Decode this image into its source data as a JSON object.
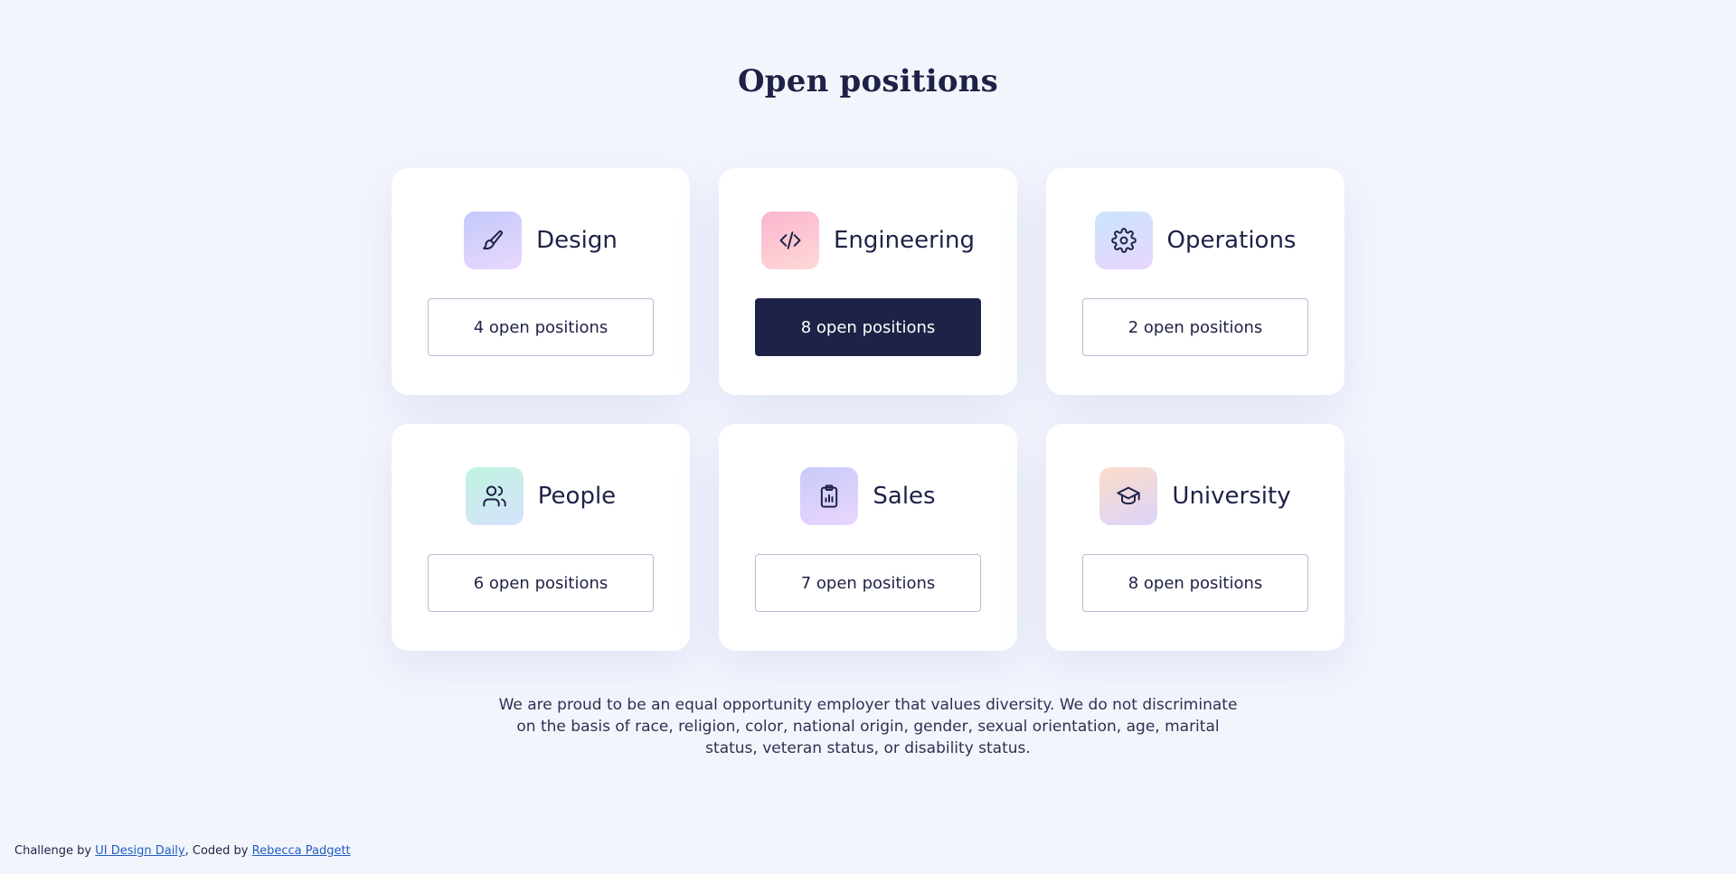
{
  "page": {
    "title": "Open positions",
    "statement": "We are proud to be an equal opportunity employer that values diversity. We do not discriminate on the basis of race, religion, color, national origin, gender, sexual orientation, age, marital status, veteran status, or disability status."
  },
  "departments": [
    {
      "name": "Design",
      "positions": "4 open positions",
      "icon": "paintbrush-icon",
      "active": false
    },
    {
      "name": "Engineering",
      "positions": "8 open positions",
      "icon": "code-icon",
      "active": true
    },
    {
      "name": "Operations",
      "positions": "2 open positions",
      "icon": "gear-icon",
      "active": false
    },
    {
      "name": "People",
      "positions": "6 open positions",
      "icon": "users-icon",
      "active": false
    },
    {
      "name": "Sales",
      "positions": "7 open positions",
      "icon": "clipboard-chart-icon",
      "active": false
    },
    {
      "name": "University",
      "positions": "8 open positions",
      "icon": "graduation-cap-icon",
      "active": false
    }
  ],
  "attribution": {
    "prefix": "Challenge by ",
    "challenge_link": "UI Design Daily",
    "middle": ", Coded by ",
    "author_link": "Rebecca Padgett"
  },
  "colors": {
    "background": "#f3f5fd",
    "text_primary": "#1e2246",
    "button_active": "#1e2246",
    "link": "#1f5fc0"
  }
}
